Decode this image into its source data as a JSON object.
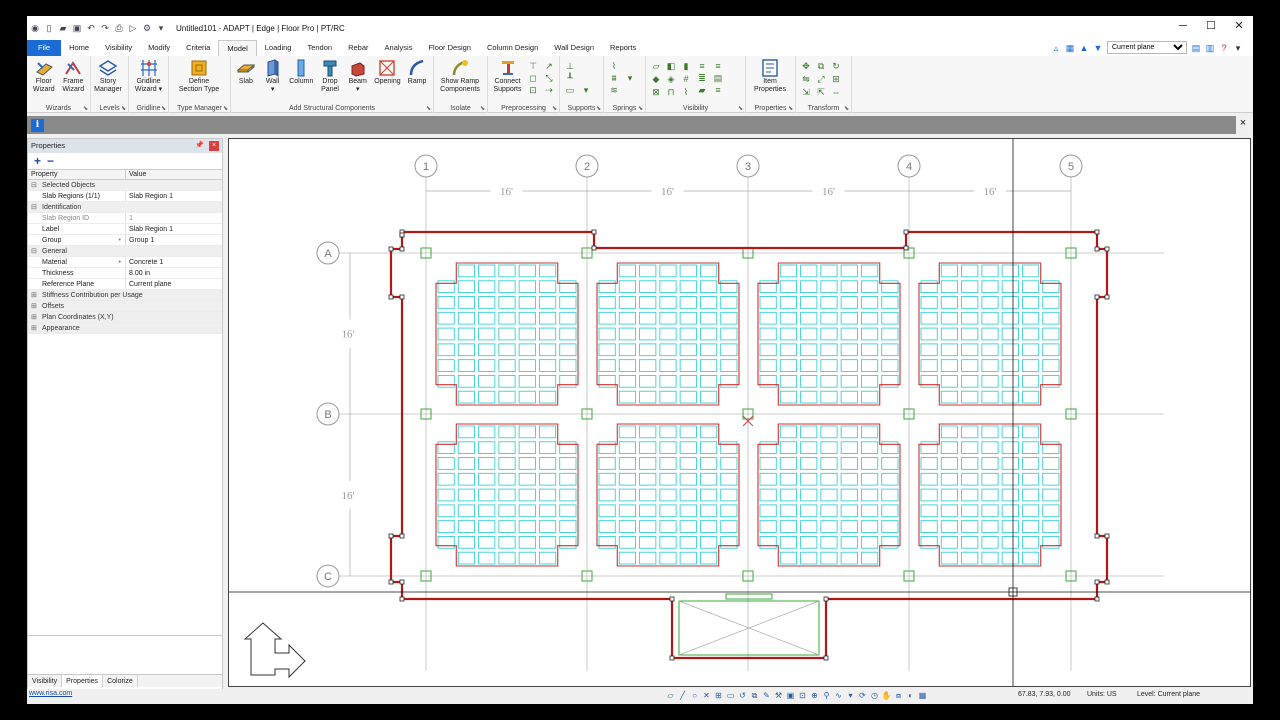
{
  "window": {
    "title": "Untitled101 - ADAPT | Edge | Floor Pro | PT/RC",
    "minimize": "─",
    "maximize": "☐",
    "close": "✕"
  },
  "menu_tabs": [
    {
      "label": "File",
      "kind": "file"
    },
    {
      "label": "Home"
    },
    {
      "label": "Visibility"
    },
    {
      "label": "Modify"
    },
    {
      "label": "Criteria"
    },
    {
      "label": "Model",
      "active": true
    },
    {
      "label": "Loading"
    },
    {
      "label": "Tendon"
    },
    {
      "label": "Rebar"
    },
    {
      "label": "Analysis"
    },
    {
      "label": "Floor Design"
    },
    {
      "label": "Column Design"
    },
    {
      "label": "Wall Design"
    },
    {
      "label": "Reports"
    }
  ],
  "plane_selector": {
    "value": "Current plane"
  },
  "ribbon": {
    "wizards": {
      "label": "Wizards",
      "buttons": [
        "Floor\nWizard",
        "Frame\nWizard"
      ]
    },
    "levels": {
      "label": "Levels",
      "buttons": [
        "Story\nManager"
      ]
    },
    "gridline": {
      "label": "Gridline",
      "buttons": [
        "Gridline\nWizard ▾"
      ]
    },
    "type_manager": {
      "label": "Type Manager",
      "buttons": [
        "Define\nSection Type"
      ]
    },
    "structural": {
      "label": "Add Structural Components",
      "buttons": [
        "Slab",
        "Wall\n▾",
        "Column",
        "Drop\nPanel",
        "Beam\n▾",
        "Opening",
        "Ramp"
      ]
    },
    "isolate": {
      "label": "Isolate",
      "buttons": [
        "Show Ramp\nComponents"
      ]
    },
    "preprocessing": {
      "label": "Preprocessing",
      "buttons": [
        "Connect\nSupports"
      ]
    },
    "supports": {
      "label": "Supports"
    },
    "springs": {
      "label": "Springs"
    },
    "visibility": {
      "label": "Visibility"
    },
    "properties": {
      "label": "Properties",
      "buttons": [
        "Item\nProperties"
      ]
    },
    "transform": {
      "label": "Transform"
    }
  },
  "info_bar": {
    "icon": "i",
    "close": "×"
  },
  "properties_panel": {
    "title": "Properties",
    "pin": "📌",
    "close": "×",
    "add": "+",
    "remove": "−",
    "columns": {
      "property": "Property",
      "value": "Value"
    },
    "rows": [
      {
        "kind": "cat",
        "key": "Selected Objects"
      },
      {
        "key": "Slab Regions (1/1)",
        "value": "Slab Region 1"
      },
      {
        "kind": "cat",
        "key": "Identification"
      },
      {
        "key": "Slab Region ID",
        "value": "1",
        "dim": true
      },
      {
        "key": "Label",
        "value": "Slab Region 1"
      },
      {
        "key": "Group",
        "value": "Group 1",
        "dot": true
      },
      {
        "kind": "cat",
        "key": "General"
      },
      {
        "key": "Material",
        "value": "Concrete 1",
        "dot": true
      },
      {
        "key": "Thickness",
        "value": "8.00 in"
      },
      {
        "key": "Reference Plane",
        "value": "Current plane"
      },
      {
        "kind": "cat",
        "key": "Stiffness Contribution per Usage",
        "closed": true
      },
      {
        "kind": "cat",
        "key": "Offsets",
        "closed": true
      },
      {
        "kind": "cat",
        "key": "Plan Coordinates (X,Y)",
        "closed": true
      },
      {
        "kind": "cat",
        "key": "Appearance",
        "closed": true
      }
    ],
    "bottom_tabs": [
      "Visibility",
      "Properties",
      "Colorize"
    ]
  },
  "canvas": {
    "gridlines_x": [
      "1",
      "2",
      "3",
      "4",
      "5"
    ],
    "gridlines_y": [
      "A",
      "B",
      "C"
    ],
    "dim_x": [
      "16'",
      "16'",
      "16'",
      "16'"
    ],
    "dim_y": [
      "16'",
      "16'"
    ],
    "colors": {
      "slab": "#b01818",
      "drop": "#d03030",
      "rib": "#36d0d8",
      "support": "#3aa83a",
      "grid": "#bbbbbb",
      "cursor": "#111111"
    }
  },
  "status_bar": {
    "link": "www.risa.com",
    "coords": "67.83, 7.93, 0.00",
    "units": "Units: US",
    "level": "Level: Current plane"
  }
}
